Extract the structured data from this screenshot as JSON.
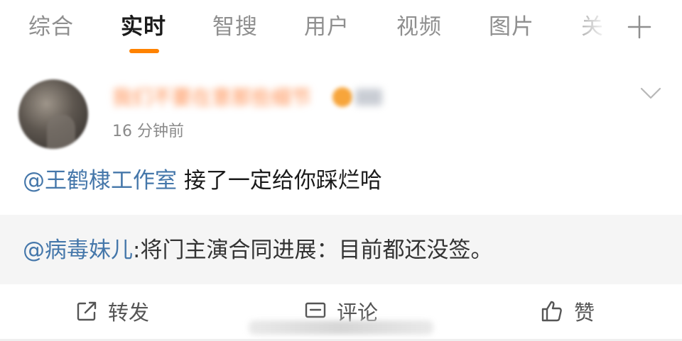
{
  "tabs": [
    {
      "label": "综合",
      "active": false
    },
    {
      "label": "实时",
      "active": true
    },
    {
      "label": "智搜",
      "active": false
    },
    {
      "label": "用户",
      "active": false
    },
    {
      "label": "视频",
      "active": false
    },
    {
      "label": "图片",
      "active": false
    },
    {
      "label": "关",
      "active": false
    }
  ],
  "tab_icons": {
    "add": "plus-icon"
  },
  "accent_color": "#ff8200",
  "post": {
    "username": "我们不要在意那些细节",
    "timestamp": "16 分钟前",
    "mention": "@王鹤棣工作室",
    "text": " 接了一定给你踩烂哈",
    "menu_icon": "chevron-down-icon"
  },
  "repost": {
    "mention": "@病毒妹儿",
    "text": ":将门主演合同进展：目前都还没签。"
  },
  "actions": {
    "repost_label": "转发",
    "comment_label": "评论",
    "like_label": "赞"
  },
  "colors": {
    "mention": "#4577aa",
    "active_tab": "#1a1a1a",
    "inactive_tab": "#8f8f8f",
    "repost_bg": "#f5f5f5"
  }
}
